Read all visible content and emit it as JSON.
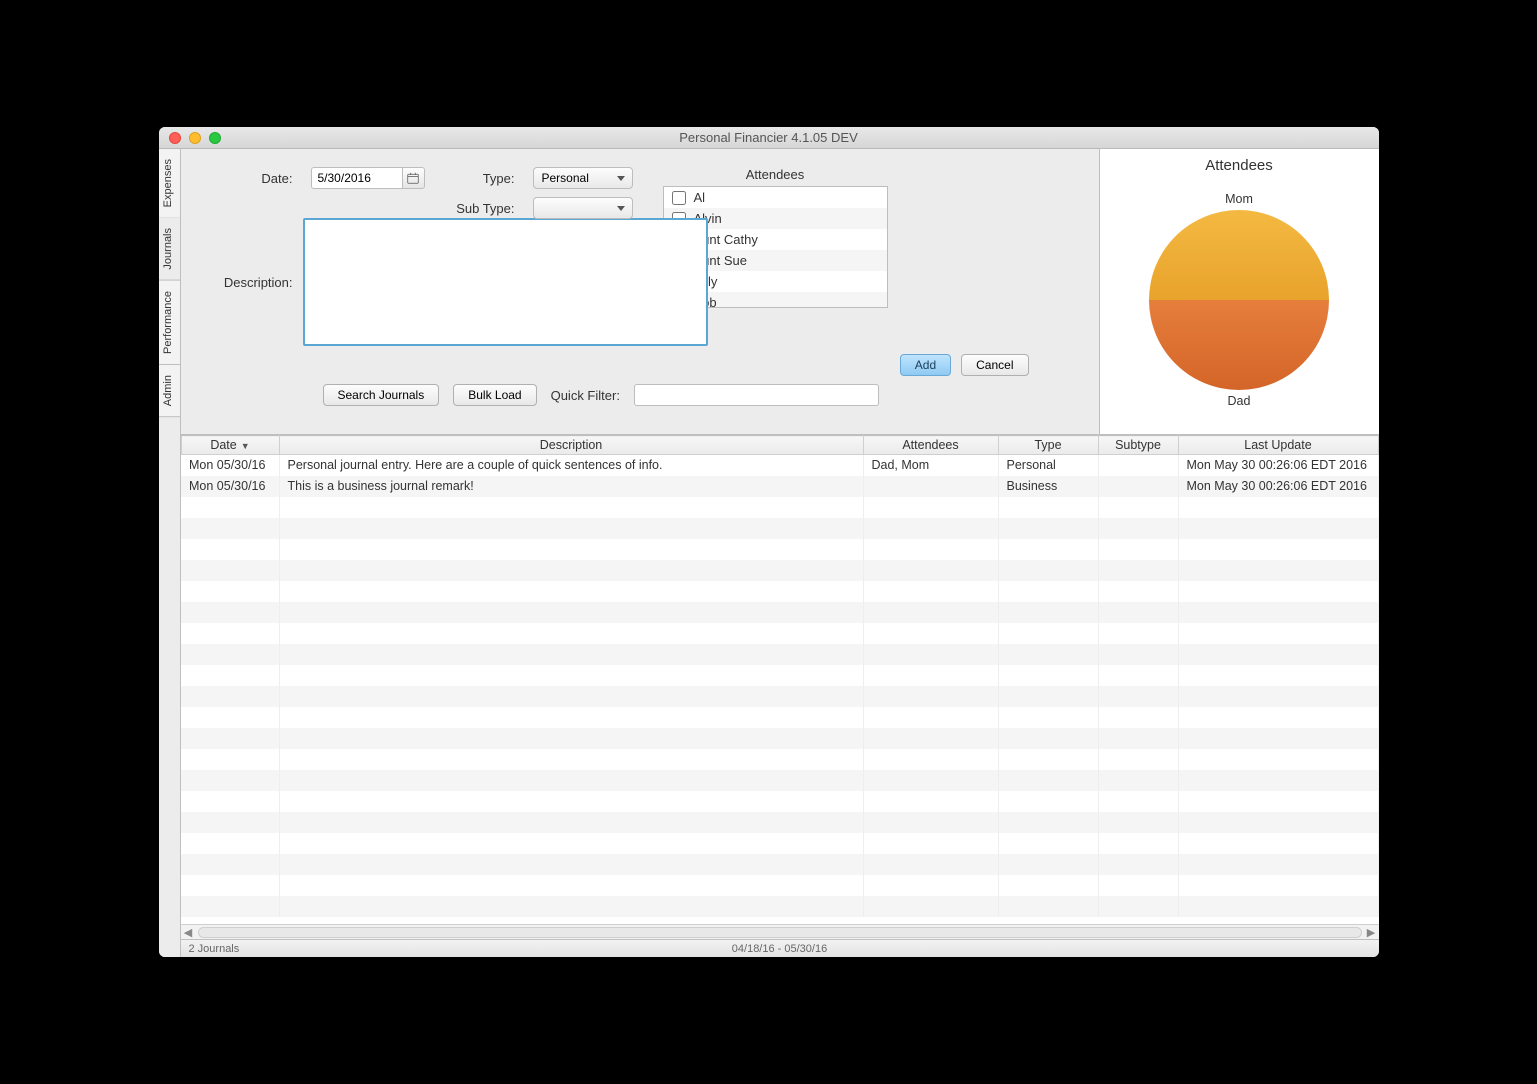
{
  "window": {
    "title": "Personal Financier 4.1.05 DEV"
  },
  "sidetabs": [
    "Expenses",
    "Journals",
    "Performance",
    "Admin"
  ],
  "form": {
    "date_label": "Date:",
    "date_value": "5/30/2016",
    "type_label": "Type:",
    "type_value": "Personal",
    "subtype_label": "Sub Type:",
    "subtype_value": "",
    "description_label": "Description:",
    "description_value": "",
    "attendees_label": "Attendees",
    "attendees": [
      "Al",
      "Alvin",
      "Aunt Cathy",
      "Aunt Sue",
      "Billy",
      "Bob"
    ],
    "add_label": "Add",
    "cancel_label": "Cancel",
    "search_label": "Search Journals",
    "bulk_label": "Bulk Load",
    "quickfilter_label": "Quick Filter:",
    "quickfilter_value": ""
  },
  "grid": {
    "columns": [
      "Date",
      "Description",
      "Attendees",
      "Type",
      "Subtype",
      "Last Update"
    ],
    "sort_indicator": "▼",
    "rows": [
      {
        "date": "Mon 05/30/16",
        "description": "Personal journal entry.  Here are a couple of quick sentences of info.",
        "attendees": "Dad, Mom",
        "type": "Personal",
        "subtype": "",
        "last_update": "Mon May 30 00:26:06 EDT 2016"
      },
      {
        "date": "Mon 05/30/16",
        "description": "This is a business journal remark!",
        "attendees": "",
        "type": "Business",
        "subtype": "",
        "last_update": "Mon May 30 00:26:06 EDT 2016"
      }
    ]
  },
  "status": {
    "left": "2 Journals",
    "center": "04/18/16 - 05/30/16"
  },
  "chart": {
    "title": "Attendees",
    "label_top": "Mom",
    "label_bottom": "Dad"
  },
  "chart_data": {
    "type": "pie",
    "title": "Attendees",
    "series": [
      {
        "name": "Mom",
        "value": 1,
        "color": "#eda936"
      },
      {
        "name": "Dad",
        "value": 1,
        "color": "#de6f32"
      }
    ]
  }
}
